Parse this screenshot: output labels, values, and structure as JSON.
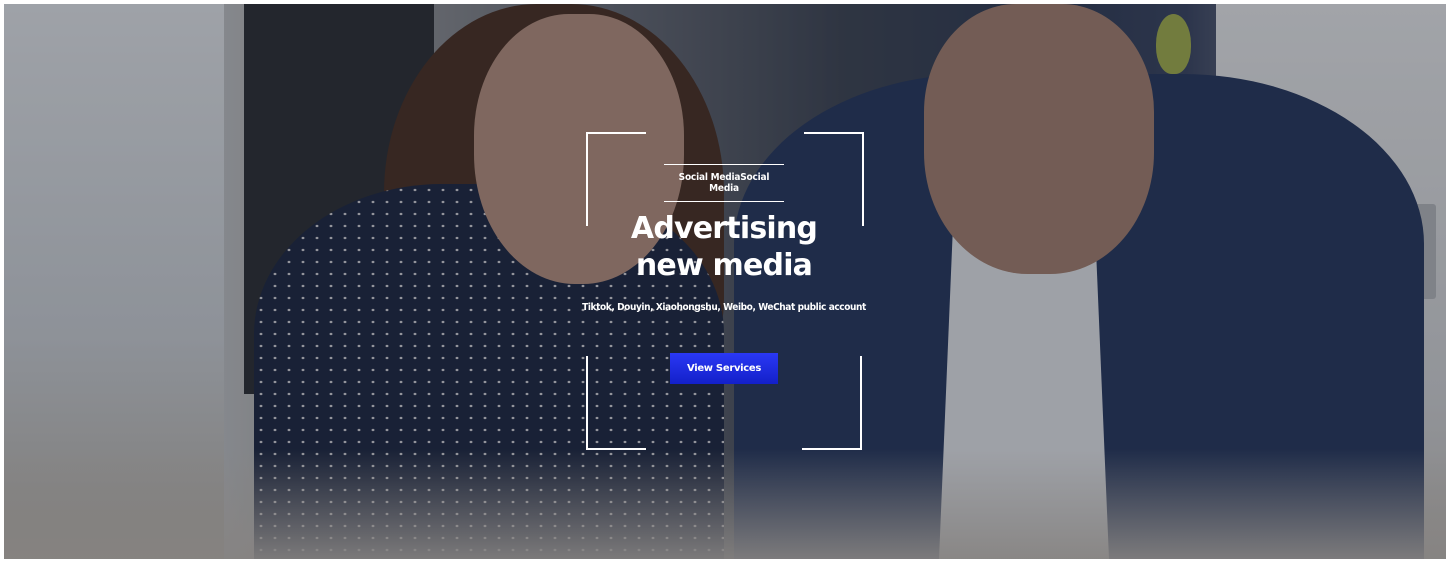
{
  "hero": {
    "tagline": "Social MediaSocial Media",
    "title": "Advertising new media",
    "subtitle": "Tiktok, Douyin, Xiaohongshu, Weibo, WeChat public account",
    "button_label": "View Services"
  },
  "colors": {
    "button": "#1a28e0",
    "text": "#ffffff"
  }
}
